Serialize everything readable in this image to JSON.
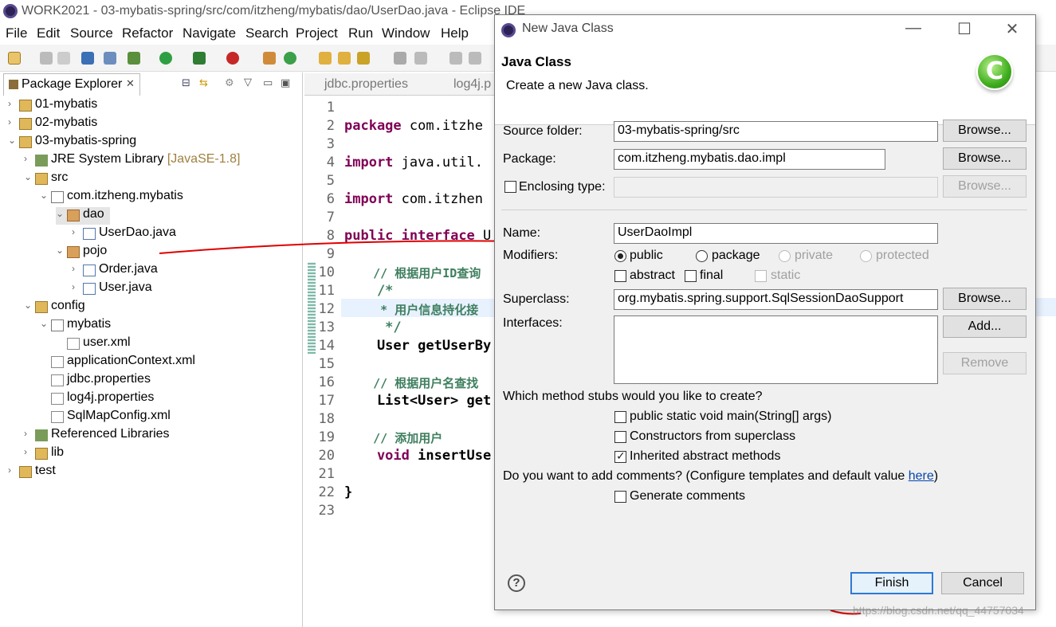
{
  "window": {
    "title": "WORK2021 - 03-mybatis-spring/src/com/itzheng/mybatis/dao/UserDao.java - Eclipse IDE"
  },
  "menu": [
    "File",
    "Edit",
    "Source",
    "Refactor",
    "Navigate",
    "Search",
    "Project",
    "Run",
    "Window",
    "Help"
  ],
  "package_explorer": {
    "tab_label": "Package Explorer",
    "items": [
      {
        "label": "01-mybatis"
      },
      {
        "label": "02-mybatis"
      },
      {
        "label": "03-mybatis-spring"
      },
      {
        "label": "JRE System Library",
        "suffix": "[JavaSE-1.8]"
      },
      {
        "label": "src"
      },
      {
        "label": "com.itzheng.mybatis"
      },
      {
        "label": "dao"
      },
      {
        "label": "UserDao.java"
      },
      {
        "label": "pojo"
      },
      {
        "label": "Order.java"
      },
      {
        "label": "User.java"
      },
      {
        "label": "config"
      },
      {
        "label": "mybatis"
      },
      {
        "label": "user.xml"
      },
      {
        "label": "applicationContext.xml"
      },
      {
        "label": "jdbc.properties"
      },
      {
        "label": "log4j.properties"
      },
      {
        "label": "SqlMapConfig.xml"
      },
      {
        "label": "Referenced Libraries"
      },
      {
        "label": "lib"
      },
      {
        "label": "test"
      }
    ]
  },
  "editor": {
    "tabs": [
      "jdbc.properties",
      "log4j.p"
    ],
    "line_numbers": [
      "1",
      "2",
      "3",
      "4",
      "5",
      "6",
      "7",
      "8",
      "9",
      "10",
      "11",
      "12",
      "13",
      "14",
      "15",
      "16",
      "17",
      "18",
      "19",
      "20",
      "21",
      "22",
      "23"
    ],
    "lines": {
      "l2a": "package",
      "l2b": " com.itzhe",
      "l4a": "import",
      "l4b": " java.util.",
      "l6a": "import",
      "l6b": " com.itzhen",
      "l8a": "public",
      "l8b": " ",
      "l8c": "interface",
      "l8d": " U",
      "l10": "    // 根据用户ID查询",
      "l11": "    /*",
      "l12": "     * 用户信息持化接",
      "l13": "     */",
      "l14": "    User getUserBy",
      "l16": "    // 根据用户名查找",
      "l17": "    List<User> get",
      "l19": "    // 添加用户",
      "l20a": "    void",
      "l20b": " insertUse",
      "l22": "}"
    }
  },
  "dialog": {
    "title": "New Java Class",
    "heading": "Java Class",
    "subheading": "Create a new Java class.",
    "labels": {
      "source_folder": "Source folder:",
      "package": "Package:",
      "enclosing_type": "Enclosing type:",
      "name": "Name:",
      "modifiers": "Modifiers:",
      "superclass": "Superclass:",
      "interfaces": "Interfaces:",
      "stubs_question": "Which method stubs would you like to create?",
      "comments_question": "Do you want to add comments? (Configure templates and default value ",
      "comments_link": "here",
      "comments_close": ")"
    },
    "values": {
      "source_folder": "03-mybatis-spring/src",
      "package": "com.itzheng.mybatis.dao.impl",
      "enclosing_type": "",
      "name": "UserDaoImpl",
      "superclass": "org.mybatis.spring.support.SqlSessionDaoSupport"
    },
    "modifiers": {
      "public": "public",
      "package": "package",
      "private": "private",
      "protected": "protected",
      "abstract": "abstract",
      "final": "final",
      "static": "static",
      "selected": "public"
    },
    "stubs": {
      "main": "public static void main(String[] args)",
      "constructors": "Constructors from superclass",
      "inherited": "Inherited abstract methods"
    },
    "generate_comments": "Generate comments",
    "buttons": {
      "browse": "Browse...",
      "add": "Add...",
      "remove": "Remove",
      "finish": "Finish",
      "cancel": "Cancel"
    }
  },
  "watermark": "https://blog.csdn.net/qq_44757034",
  "colors": {
    "keyword": "#7f0055",
    "comment": "#3f7f5f",
    "annotation_red": "#e00000",
    "default_button_border": "#2d79d6",
    "link": "#0645ad"
  }
}
